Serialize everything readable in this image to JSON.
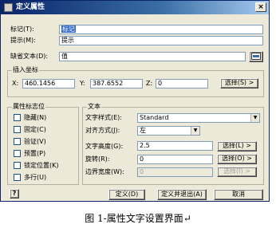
{
  "window": {
    "title": "定义属性",
    "close_label": "×",
    "help_label": "?"
  },
  "attributes": {
    "tag_label": "标记(T):",
    "tag_value": "标记",
    "prompt_label": "提示(M):",
    "prompt_value": "提示",
    "default_label": "缺省文本(D):",
    "default_value": "值",
    "field_icon": "insert-field-icon"
  },
  "insert_point": {
    "group_title": "插入坐标",
    "x_label": "X:",
    "x_value": "460.1456",
    "y_label": "Y:",
    "y_value": "387.6552",
    "z_label": "Z:",
    "z_value": "0",
    "pick_button": "选择(S) >"
  },
  "attribute_flags": {
    "group_title": "属性标志位",
    "items": [
      {
        "label": "隐藏(N)",
        "checked": false
      },
      {
        "label": "固定(C)",
        "checked": false
      },
      {
        "label": "验证(V)",
        "checked": false
      },
      {
        "label": "预置(P)",
        "checked": false
      },
      {
        "label": "锁定位置(K)",
        "checked": false
      },
      {
        "label": "多行(U)",
        "checked": false
      }
    ]
  },
  "text": {
    "group_title": "文本",
    "style_label": "文字样式(E):",
    "style_value": "Standard",
    "justify_label": "对齐方式(J):",
    "justify_value": "左",
    "height_label": "文字高度(G):",
    "height_value": "2.5",
    "height_button": "选择(L) >",
    "rotation_label": "旋转(R):",
    "rotation_value": "0",
    "rotation_button": "选择(O) >",
    "width_label": "边界宽度(W):",
    "width_value": "0",
    "width_button": "选择(I) >"
  },
  "footer": {
    "ok_button": "定义(D)",
    "ok_exit_button": "定义并退出(A)",
    "cancel_button": "取消"
  },
  "caption": "图 1-属性文字设置界面↵"
}
